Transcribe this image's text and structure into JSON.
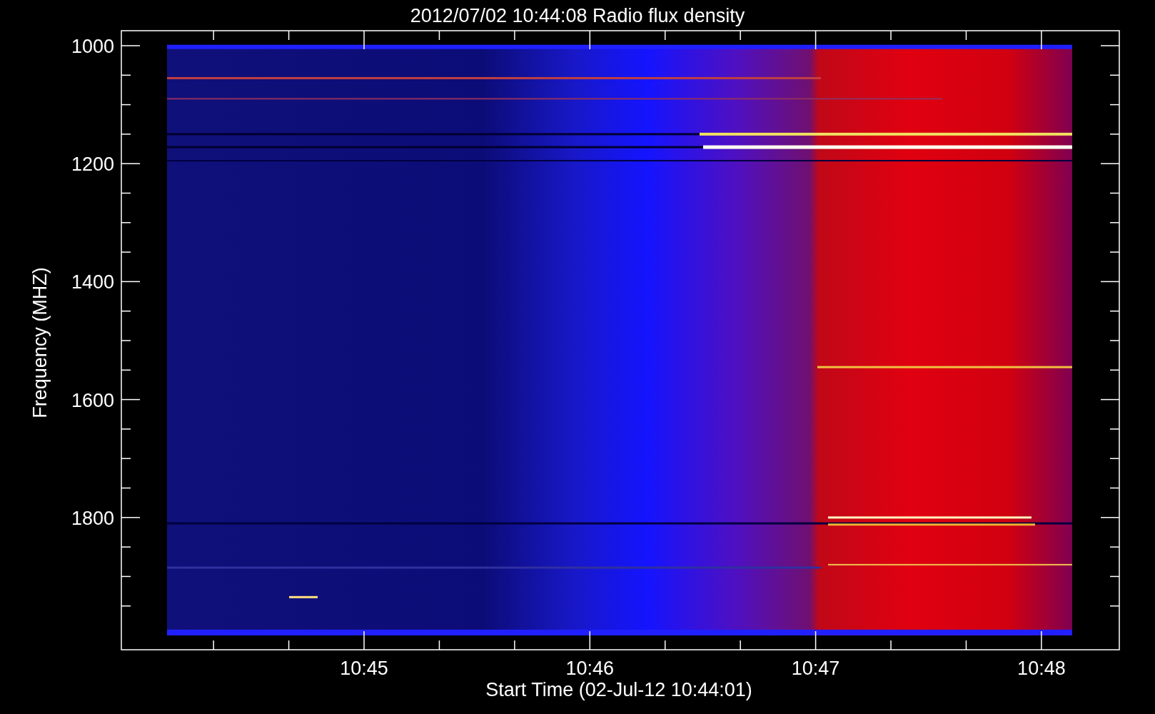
{
  "title": "2012/07/02 10:44:08 Radio flux density",
  "plot": {
    "ylabel": "Frequency (MHZ)",
    "xlabel": "Start Time (02-Jul-12 10:44:01)",
    "yticks": [
      "1000",
      "1200",
      "1400",
      "1600",
      "1800"
    ],
    "xticks": [
      "10:45",
      "10:46",
      "10:47",
      "10:48"
    ]
  }
}
